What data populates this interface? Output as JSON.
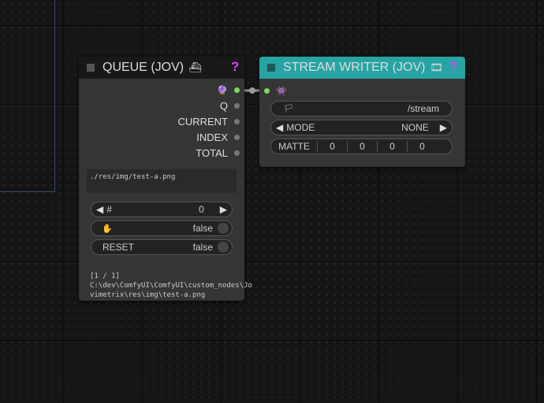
{
  "queue_node": {
    "title": "QUEUE (JOV)",
    "title_icon": "⛴",
    "help": "?",
    "outputs": {
      "q": "Q",
      "current": "CURRENT",
      "index": "INDEX",
      "total": "TOTAL"
    },
    "queue_text": "./res/img/test-a.png",
    "index_widget": {
      "label": "#",
      "value": "0"
    },
    "hold_toggle": {
      "value": "false"
    },
    "reset_toggle": {
      "label": "RESET",
      "value": "false"
    },
    "status_text": {
      "line1": "[1 / 1]",
      "line2": "C:\\dev\\ComfyUI\\ComfyUI\\custom_nodes\\Jo",
      "line3": "vimetrix\\res\\img\\test-a.png"
    }
  },
  "stream_node": {
    "title": "STREAM WRITER (JOV)",
    "title_icon": "🎞",
    "help": "?",
    "route_widget": {
      "value": "/stream"
    },
    "mode_widget": {
      "label": "MODE",
      "value": "NONE"
    },
    "matte_widget": {
      "label": "MATTE",
      "values": [
        "0",
        "0",
        "0",
        "0"
      ]
    }
  },
  "colors": {
    "stream_title_bg": "#27a3a3",
    "queue_title_bg": "#181818",
    "help": "#e040fb",
    "link": "#9a9a9a",
    "active_slot": "#7dd85b"
  }
}
